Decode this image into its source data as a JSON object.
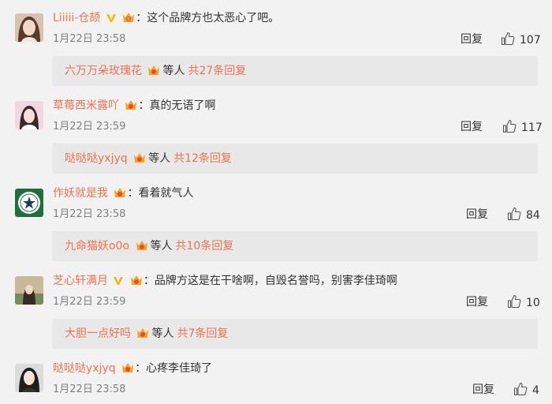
{
  "comments": [
    {
      "username": "Liiiii-仓颉",
      "verified": true,
      "colon": "：",
      "content": "这个品牌方也太恶心了吧。",
      "time": "1月22日 23:58",
      "reply_label": "回复",
      "likes": "107",
      "thread": {
        "user": "六万万朵玫瑰花",
        "etc": "等人",
        "count": "共27条回复"
      }
    },
    {
      "username": "草莓西米露吖",
      "verified": false,
      "colon": "：",
      "content": "真的无语了啊",
      "time": "1月22日 23:59",
      "reply_label": "回复",
      "likes": "117",
      "thread": {
        "user": "哒哒哒yxjyq",
        "etc": "等人",
        "count": "共12条回复"
      }
    },
    {
      "username": "作妖就是我",
      "verified": false,
      "colon": "：",
      "content": "看着就气人",
      "time": "1月22日 23:58",
      "reply_label": "回复",
      "likes": "84",
      "thread": {
        "user": "九命猫妖o0o",
        "etc": "等人",
        "count": "共10条回复"
      }
    },
    {
      "username": "芝心轩满月",
      "verified": true,
      "colon": "：",
      "content": "品牌方这是在干啥啊，自毁名誉吗，别害李佳琦啊",
      "time": "1月22日 23:59",
      "reply_label": "回复",
      "likes": "10",
      "thread": {
        "user": "大胆一点好吗",
        "etc": "等人",
        "count": "共7条回复"
      }
    },
    {
      "username": "哒哒哒yxjyq",
      "verified": false,
      "colon": "：",
      "content": "心疼李佳琦了",
      "time": "1月22日 23:58",
      "reply_label": "回复",
      "likes": "4"
    }
  ],
  "colors": {
    "username": "#eb7350",
    "background": "#f2f2f2",
    "reply_box": "#e8e8e8",
    "time": "#808080",
    "verified_badge": "#f7b500"
  },
  "icons": {
    "verified": "verified-v-icon",
    "member": "member-crown-icon",
    "like": "thumbs-up-icon"
  }
}
